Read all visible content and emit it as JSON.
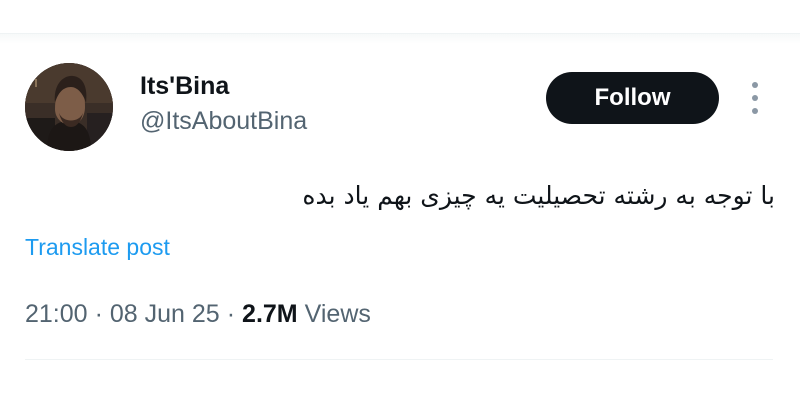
{
  "author": {
    "display_name": "Its'Bina",
    "handle": "@ItsAboutBina"
  },
  "actions": {
    "follow_label": "Follow"
  },
  "tweet": {
    "text": "با توجه به رشته تحصیلیت یه چیزی بهم یاد بده",
    "translate_label": "Translate post"
  },
  "meta": {
    "time": "21:00",
    "separator": "·",
    "date": "08 Jun 25",
    "views_count": "2.7M",
    "views_label": "Views"
  },
  "colors": {
    "accent": "#1d9bf0",
    "follow_bg": "#0f1419",
    "secondary_text": "#536471"
  }
}
